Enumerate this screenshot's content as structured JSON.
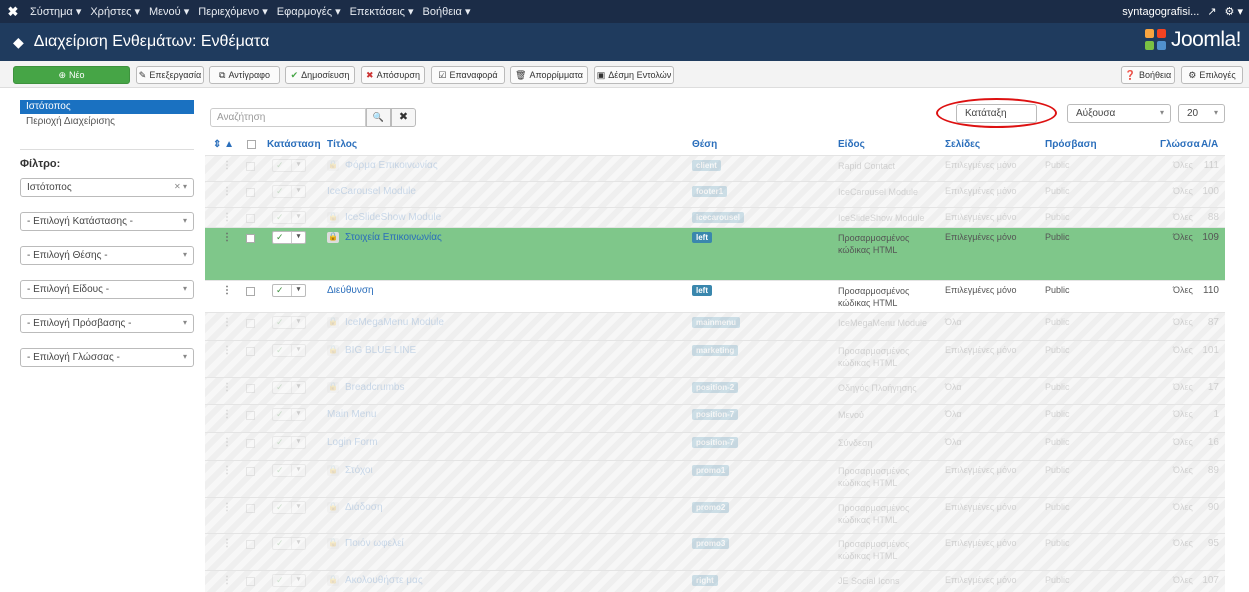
{
  "topbar": {
    "menu": [
      "Σύστημα ▾",
      "Χρήστες ▾",
      "Μενού ▾",
      "Περιεχόμενο ▾",
      "Εφαρμογές ▾",
      "Επεκτάσεις ▾",
      "Βοήθεια ▾"
    ],
    "user": "syntagografisi...",
    "ext_icon": "↗",
    "gear": "⚙ ▾"
  },
  "header": {
    "title": "Διαχείριση Ενθεμάτων: Ενθέματα",
    "brand": "Joomla!"
  },
  "toolbar": {
    "new": "Νέο",
    "edit": "Επεξεργασία",
    "copy": "Αντίγραφο",
    "publish": "Δημοσίευση",
    "unpublish": "Απόσυρση",
    "checkin": "Επαναφορά",
    "trash": "Απορρίμματα",
    "batch": "Δέσμη Εντολών",
    "help": "Βοήθεια",
    "options": "Επιλογές"
  },
  "sidebar": {
    "site": "Ιστότοπος",
    "admin": "Περιοχή Διαχείρισης",
    "filter_label": "Φίλτρο:",
    "filters": [
      "Ιστότοπος",
      "- Επιλογή Κατάστασης -",
      "- Επιλογή Θέσης -",
      "- Επιλογή Είδους -",
      "- Επιλογή Πρόσβασης -",
      "- Επιλογή Γλώσσας -"
    ]
  },
  "search": {
    "placeholder": "Αναζήτηση",
    "search_icon": "🔍",
    "clear_icon": "✖"
  },
  "sort": {
    "field": "Κατάταξη",
    "dir": "Αύξουσα",
    "limit": "20"
  },
  "table": {
    "headers": {
      "sort": "⇕ ▲",
      "status": "Κατάσταση",
      "title": "Τίτλος",
      "position": "Θέση",
      "type": "Είδος",
      "pages": "Σελίδες",
      "access": "Πρόσβαση",
      "language": "Γλώσσα",
      "id": "Α/Α"
    },
    "rows": [
      {
        "title": "Φόρμα Επικοινωνίας",
        "position": "client",
        "type": "Rapid Contact",
        "type2": "",
        "pages": "Επιλεγμένες μόνο",
        "access": "Public",
        "lang": "Όλες",
        "id": "111"
      },
      {
        "title": "IceCarousel Module",
        "position": "footer1",
        "type": "IceCarousel Module",
        "type2": "",
        "pages": "Επιλεγμένες μόνο",
        "access": "Public",
        "lang": "Όλες",
        "id": "100"
      },
      {
        "title": "IceSlideShow Module",
        "position": "icecarousel",
        "type": "IceSlideShow Module",
        "type2": "",
        "pages": "Επιλεγμένες μόνο",
        "access": "Public",
        "lang": "Όλες",
        "id": "88"
      },
      {
        "title": "Στοιχεία Επικοινωνίας",
        "position": "left",
        "type": "Προσαρμοσμένος",
        "type2": "κώδικας HTML",
        "pages": "Επιλεγμένες μόνο",
        "access": "Public",
        "lang": "Όλες",
        "id": "109"
      },
      {
        "title": "Διεύθυνση",
        "position": "left",
        "type": "Προσαρμοσμένος",
        "type2": "κώδικας HTML",
        "pages": "Επιλεγμένες μόνο",
        "access": "Public",
        "lang": "Όλες",
        "id": "110"
      },
      {
        "title": "IceMegaMenu Module",
        "position": "mainmenu",
        "type": "IceMegaMenu Module",
        "type2": "",
        "pages": "Όλα",
        "access": "Public",
        "lang": "Όλες",
        "id": "87"
      },
      {
        "title": "BIG BLUE LINE",
        "position": "marketing",
        "type": "Προσαρμοσμένος",
        "type2": "κώδικας HTML",
        "pages": "Επιλεγμένες μόνο",
        "access": "Public",
        "lang": "Όλες",
        "id": "101"
      },
      {
        "title": "Breadcrumbs",
        "position": "position-2",
        "type": "Οδηγός Πλοήγησης",
        "type2": "",
        "pages": "Όλα",
        "access": "Public",
        "lang": "Όλες",
        "id": "17"
      },
      {
        "title": "Main Menu",
        "position": "position-7",
        "type": "Μενού",
        "type2": "",
        "pages": "Όλα",
        "access": "Public",
        "lang": "Όλες",
        "id": "1"
      },
      {
        "title": "Login Form",
        "position": "position-7",
        "type": "Σύνδεση",
        "type2": "",
        "pages": "Όλα",
        "access": "Public",
        "lang": "Όλες",
        "id": "16"
      },
      {
        "title": "Στόχοι",
        "position": "promo1",
        "type": "Προσαρμοσμένος",
        "type2": "κώδικας HTML",
        "pages": "Επιλεγμένες μόνο",
        "access": "Public",
        "lang": "Όλες",
        "id": "89"
      },
      {
        "title": "Διάδοση",
        "position": "promo2",
        "type": "Προσαρμοσμένος",
        "type2": "κώδικας HTML",
        "pages": "Επιλεγμένες μόνο",
        "access": "Public",
        "lang": "Όλες",
        "id": "90"
      },
      {
        "title": "Ποιόν ωφελεί",
        "position": "promo3",
        "type": "Προσαρμοσμένος",
        "type2": "κώδικας HTML",
        "pages": "Επιλεγμένες μόνο",
        "access": "Public",
        "lang": "Όλες",
        "id": "95"
      },
      {
        "title": "Ακολουθήστε μας",
        "position": "right",
        "type": "JE Social Icons",
        "type2": "",
        "pages": "Επιλεγμένες μόνο",
        "access": "Public",
        "lang": "Όλες",
        "id": "107"
      }
    ]
  },
  "colors": {
    "topbar": "#1b2c47",
    "header": "#1f3b5e",
    "accent": "#1a71c1",
    "highlight": "#7fc78a",
    "annotation": "#dd1111"
  },
  "icons": {
    "drag": "⋮",
    "lock": "🔒",
    "check": "✓",
    "caret": "▾"
  }
}
